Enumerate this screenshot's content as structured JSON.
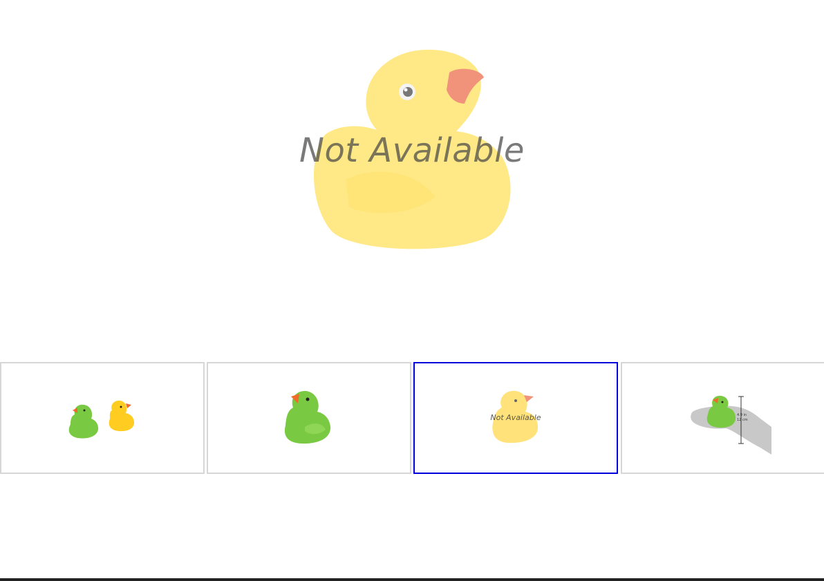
{
  "main_image": {
    "overlay_text": "Not Available",
    "subject_icon": "yellow-rubber-duck-image"
  },
  "thumbnails": [
    {
      "subject_icon": "green-and-yellow-duck-pair-image",
      "selected": false
    },
    {
      "subject_icon": "green-duck-image",
      "selected": false
    },
    {
      "subject_icon": "yellow-duck-not-available-image",
      "selected": true,
      "overlay_text": "Not Available"
    },
    {
      "subject_icon": "green-duck-in-hand-size-image",
      "selected": false,
      "dimension_labels": [
        "4.9 in",
        "12 cm"
      ]
    }
  ],
  "colors": {
    "selected_border": "#0000dd",
    "thumb_border": "#d6d6d6",
    "duck_yellow": "#ffe27a",
    "duck_green": "#7ac943",
    "beak": "#f07a5a"
  }
}
